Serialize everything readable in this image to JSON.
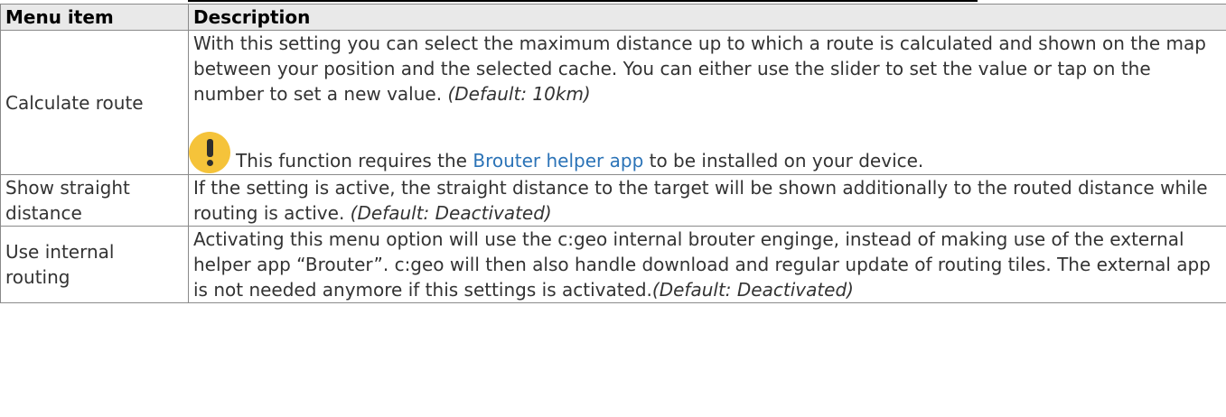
{
  "table": {
    "headers": [
      "Menu item",
      "Description"
    ],
    "rows": [
      {
        "item": "Calculate route",
        "description": "With this setting you can select the maximum distance up to which a route is calculated and shown on the map between your position and the selected cache. You can either use the slider to set the value or tap on the number to set a new value.",
        "default": "(Default: 10km)",
        "note_prefix": "This function requires the",
        "note_link": "Brouter helper app",
        "note_suffix": "to be installed on your device."
      },
      {
        "item": "Show straight distance",
        "description": "If the setting is active, the straight distance to the target will be shown additionally to the routed distance while routing is active.",
        "default": "(Default: Deactivated)"
      },
      {
        "item": "Use internal routing",
        "description": "Activating this menu option will use the c:geo internal brouter enginge, instead of making use of the external helper app “Brouter”. c:geo will then also handle download and regular update of routing tiles. The external app is not needed anymore if this settings is activated.",
        "default": "(Default: Deactivated)"
      }
    ]
  },
  "icons": {
    "warning": "exclamation-warning-icon"
  }
}
